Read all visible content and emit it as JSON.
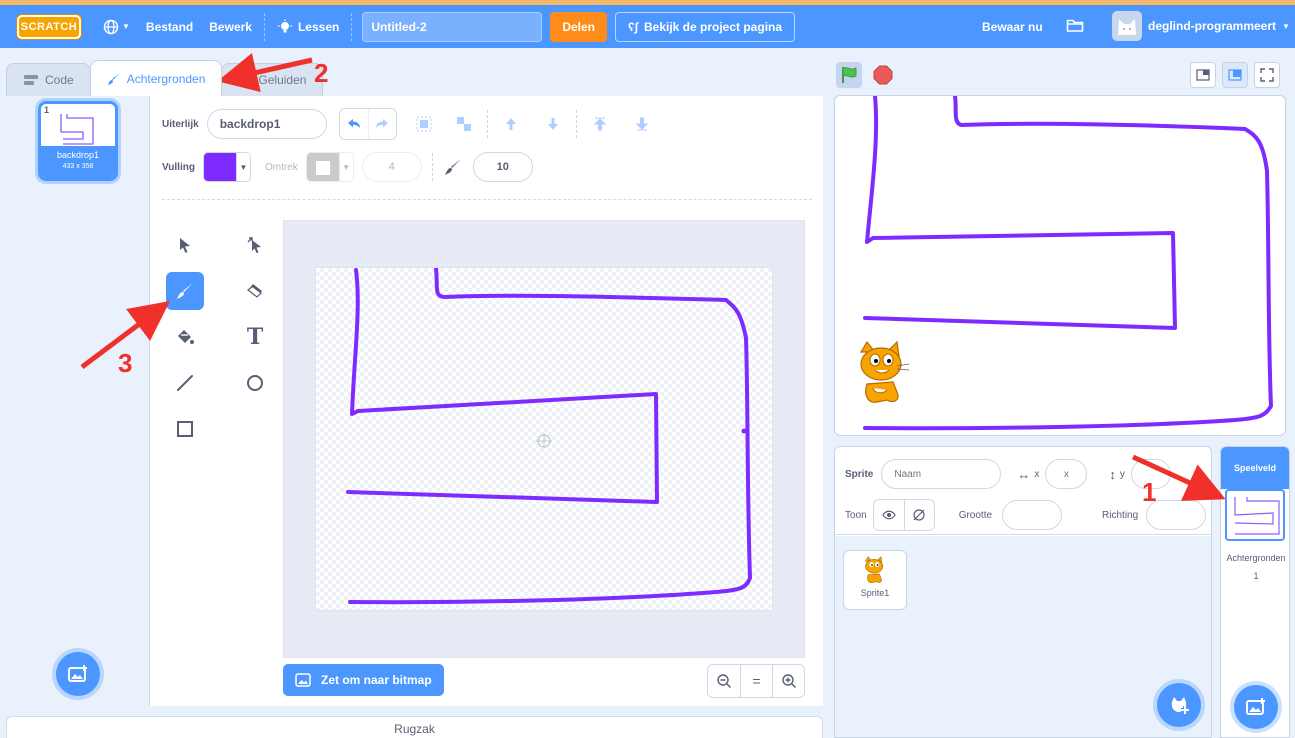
{
  "menu": {
    "logo": "SCRATCH",
    "file": "Bestand",
    "edit": "Bewerk",
    "tutorials": "Lessen",
    "project_title": "Untitled-2",
    "share": "Delen",
    "see_project_page": "Bekijk de project pagina",
    "save_now": "Bewaar nu",
    "username": "deglind-programmeert"
  },
  "tabs": {
    "code": "Code",
    "backdrops": "Achtergronden",
    "sounds": "Geluiden"
  },
  "costume_list": {
    "items": [
      {
        "number": "1",
        "name": "backdrop1",
        "size": "433 x 358"
      }
    ]
  },
  "paint_editor": {
    "costume_label": "Uiterlijk",
    "costume_name": "backdrop1",
    "fill_label": "Vulling",
    "fill_color": "#7e2bff",
    "outline_label": "Omtrek",
    "outline_width": "4",
    "brush_size": "10",
    "convert_button": "Zet om naar bitmap",
    "selected_tool": "brush"
  },
  "backpack": {
    "label": "Rugzak"
  },
  "sprite_info": {
    "sprite_label": "Sprite",
    "name_placeholder": "Naam",
    "x_label": "x",
    "x_placeholder": "x",
    "y_label": "y",
    "show_label": "Toon",
    "size_label": "Grootte",
    "direction_label": "Richting"
  },
  "sprites": [
    {
      "name": "Sprite1"
    }
  ],
  "stage_target": {
    "header": "Speelveld",
    "label": "Achtergronden",
    "count": "1"
  },
  "annotations": [
    "1",
    "2",
    "3"
  ],
  "colors": {
    "accent": "#4c97ff",
    "share": "#ff8c1a",
    "drawing": "#7e2bff",
    "annotation": "#f0302b"
  }
}
